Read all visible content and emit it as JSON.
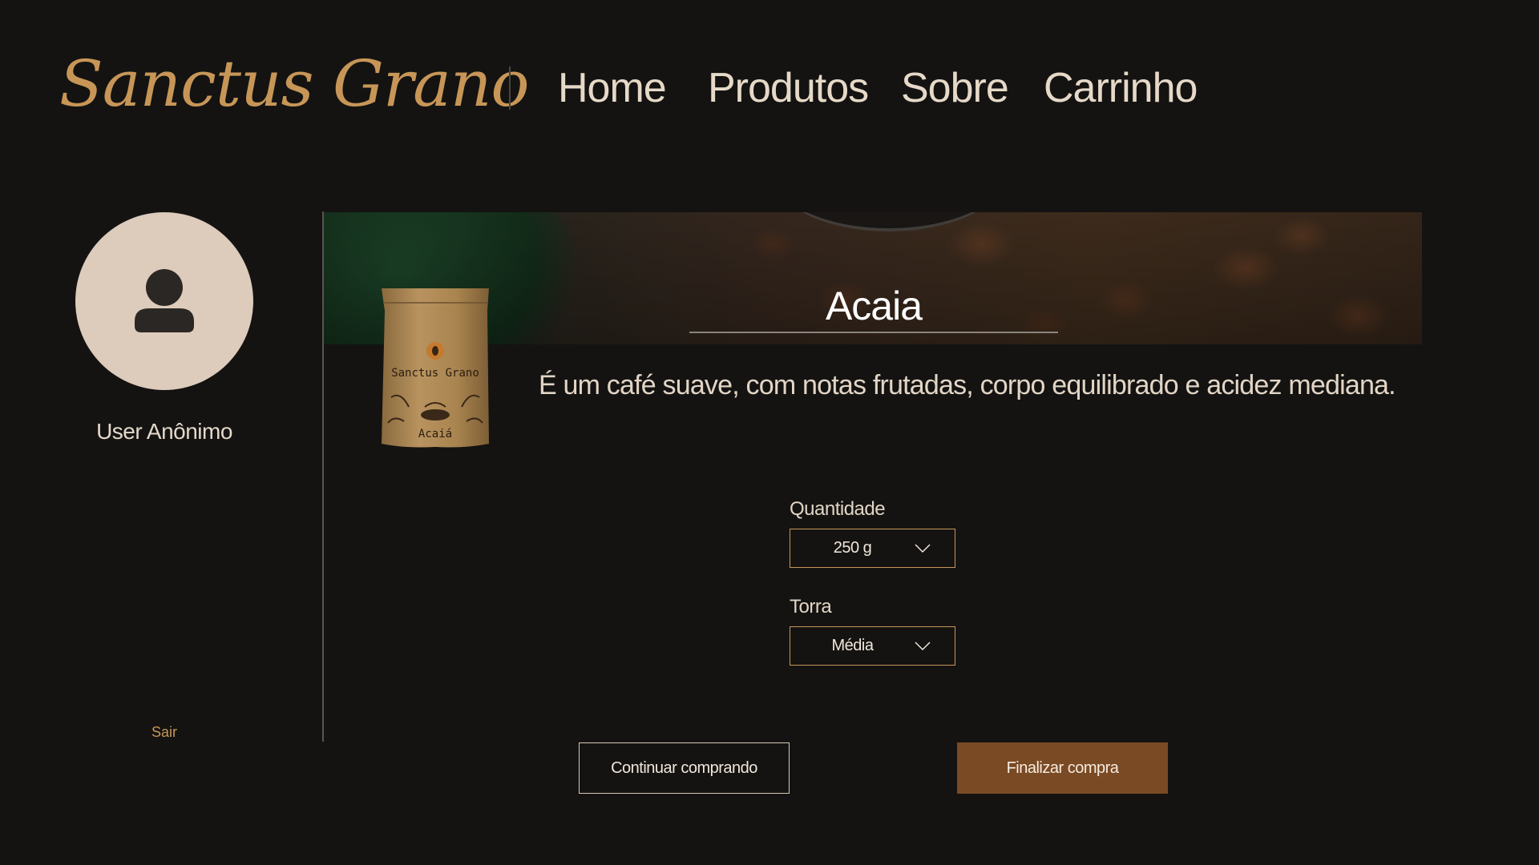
{
  "header": {
    "logo": "Sanctus Grano",
    "nav": [
      {
        "label": "Home"
      },
      {
        "label": "Produtos"
      },
      {
        "label": "Sobre"
      },
      {
        "label": "Carrinho"
      }
    ]
  },
  "sidebar": {
    "avatar_icon": "user-icon",
    "username": "User Anônimo",
    "logout_label": "Sair"
  },
  "product": {
    "title": "Acaia",
    "description": "É um café suave, com notas frutadas, corpo equilibrado e acidez mediana.",
    "bag": {
      "brand": "Sanctus Grano",
      "name": "Acaiá"
    }
  },
  "form": {
    "quantity": {
      "label": "Quantidade",
      "value": "250 g"
    },
    "roast": {
      "label": "Torra",
      "value": "Média"
    }
  },
  "actions": {
    "continue_label": "Continuar comprando",
    "checkout_label": "Finalizar compra"
  },
  "colors": {
    "background": "#141312",
    "accent": "#c79657",
    "primary_button": "#7a4a24",
    "avatar_bg": "#ddcbbb"
  }
}
